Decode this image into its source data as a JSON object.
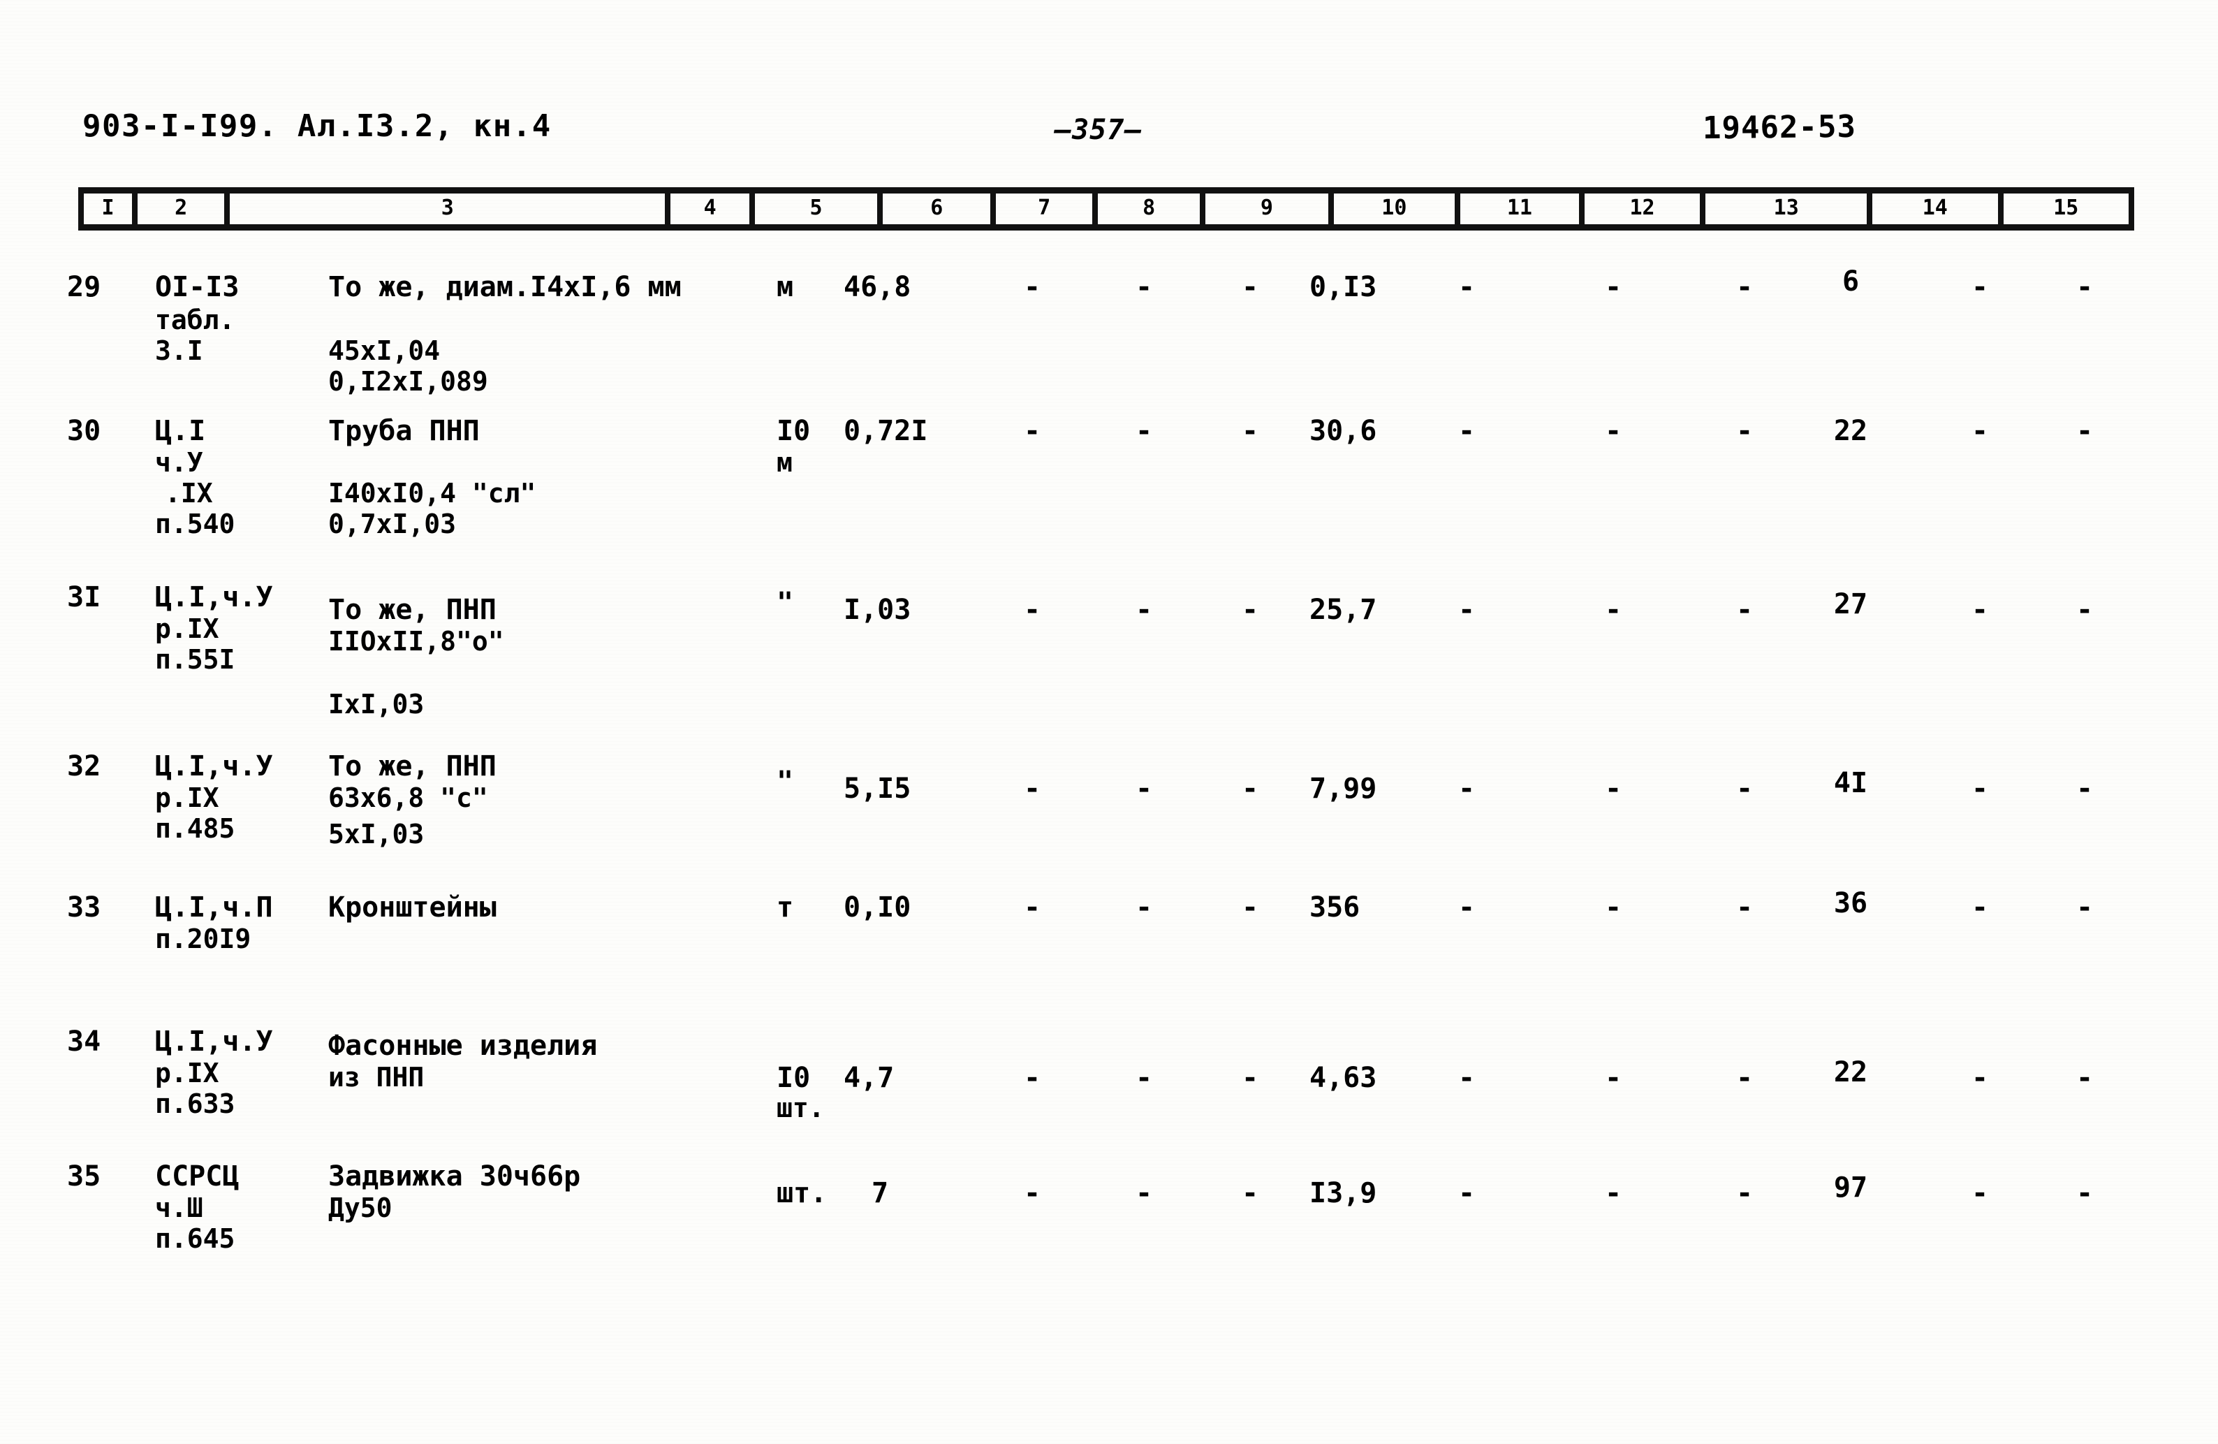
{
  "header": {
    "doc_code": "903-I-I99. Ал.I3.2, кн.4",
    "page_number": "—357—",
    "stamp_number": "19462-53"
  },
  "table": {
    "column_numbers": [
      "I",
      "2",
      "3",
      "4",
      "5",
      "6",
      "7",
      "8",
      "9",
      "10",
      "11",
      "12",
      "13",
      "14",
      "15"
    ],
    "dash": "-",
    "rows": [
      {
        "num": "29",
        "code_l1": "ОI-I3",
        "code_l2": "табл.",
        "code_l3": "3.I",
        "name_l1": "То же, диам.I4xI,6 мм",
        "name_l2": "45xI,04",
        "name_l3": "0,I2xI,089",
        "unit_l1": "м",
        "unit_l2": "",
        "c5": "46,8",
        "c6": "-",
        "c7": "-",
        "c8": "-",
        "c9": "0,I3",
        "c10": "-",
        "c11": "-",
        "c12": "-",
        "c13": "6",
        "c14": "-",
        "c15": "-"
      },
      {
        "num": "30",
        "code_l1": "Ц.I",
        "code_l2": "ч.У",
        "code_l3": ".IX",
        "code_l4": "п.540",
        "name_l1": "Труба ПНП",
        "name_l2": "I40xI0,4 \"сл\"",
        "name_l3": "0,7xI,03",
        "unit_l1": "I0",
        "unit_l2": "м",
        "c5": "0,72I",
        "c6": "-",
        "c7": "-",
        "c8": "-",
        "c9": "30,6",
        "c10": "-",
        "c11": "-",
        "c12": "-",
        "c13": "22",
        "c14": "-",
        "c15": "-"
      },
      {
        "num": "3I",
        "code_l1": "Ц.I,ч.У",
        "code_l2": "р.IX",
        "code_l3": "п.55I",
        "name_l1": "То же, ПНП",
        "name_l2": "IIОxII,8\"о\"",
        "name_l3": "IxI,03",
        "unit_l1": "\"",
        "unit_l2": "",
        "c5": "I,03",
        "c6": "-",
        "c7": "-",
        "c8": "-",
        "c9": "25,7",
        "c10": "-",
        "c11": "-",
        "c12": "-",
        "c13": "27",
        "c14": "-",
        "c15": "-"
      },
      {
        "num": "32",
        "code_l1": "Ц.I,ч.У",
        "code_l2": "р.IX",
        "code_l3": "п.485",
        "name_l1": "То же, ПНП",
        "name_l2": "63x6,8 \"с\"",
        "name_l3": "5xI,03",
        "unit_l1": "\"",
        "unit_l2": "",
        "c5": "5,I5",
        "c6": "-",
        "c7": "-",
        "c8": "-",
        "c9": "7,99",
        "c10": "-",
        "c11": "-",
        "c12": "-",
        "c13": "4I",
        "c14": "-",
        "c15": "-"
      },
      {
        "num": "33",
        "code_l1": "Ц.I,ч.П",
        "code_l2": "п.20I9",
        "code_l3": "",
        "name_l1": "Кронштейны",
        "name_l2": "",
        "name_l3": "",
        "unit_l1": "т",
        "unit_l2": "",
        "c5": "0,I0",
        "c6": "-",
        "c7": "-",
        "c8": "-",
        "c9": "356",
        "c10": "-",
        "c11": "-",
        "c12": "-",
        "c13": "36",
        "c14": "-",
        "c15": "-"
      },
      {
        "num": "34",
        "code_l1": "Ц.I,ч.У",
        "code_l2": "р.IX",
        "code_l3": "п.633",
        "name_l1": "Фасонные изделия",
        "name_l2": "из ПНП",
        "name_l3": "",
        "unit_l1": "I0",
        "unit_l2": "шт.",
        "c5": "4,7",
        "c6": "-",
        "c7": "-",
        "c8": "-",
        "c9": "4,63",
        "c10": "-",
        "c11": "-",
        "c12": "-",
        "c13": "22",
        "c14": "-",
        "c15": "-"
      },
      {
        "num": "35",
        "code_l1": "ССРСЦ",
        "code_l2": "ч.Ш",
        "code_l3": "п.645",
        "name_l1": "Задвижка 30ч66р",
        "name_l2": "Ду50",
        "name_l3": "",
        "unit_l1": "шт.",
        "unit_l2": "",
        "c5": "7",
        "c6": "-",
        "c7": "-",
        "c8": "-",
        "c9": "I3,9",
        "c10": "-",
        "c11": "-",
        "c12": "-",
        "c13": "97",
        "c14": "-",
        "c15": "-"
      }
    ]
  }
}
